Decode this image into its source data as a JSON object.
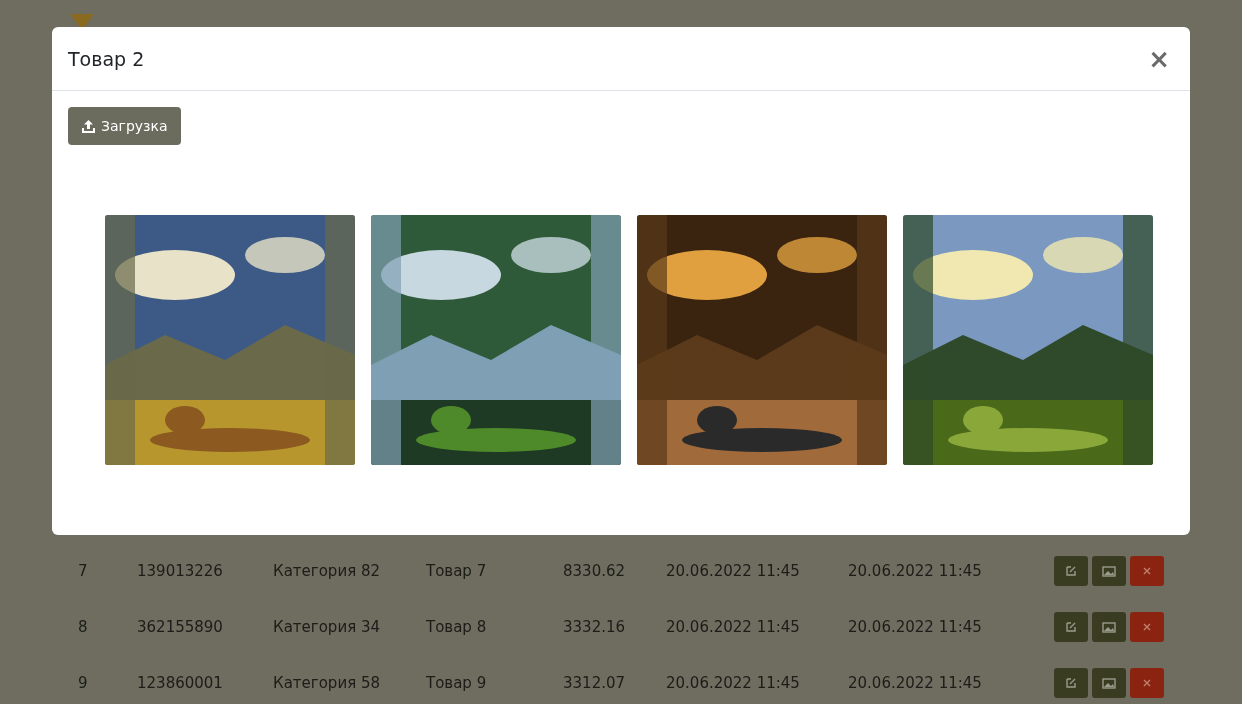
{
  "table": {
    "rows": [
      {
        "cells": [
          "7",
          "139013226",
          "Категория 82",
          "Товар 7",
          "8330.62",
          "20.06.2022 11:45",
          "20.06.2022 11:45"
        ]
      },
      {
        "cells": [
          "8",
          "362155890",
          "Категория 34",
          "Товар 8",
          "3332.16",
          "20.06.2022 11:45",
          "20.06.2022 11:45"
        ]
      },
      {
        "cells": [
          "9",
          "123860001",
          "Категория 58",
          "Товар 9",
          "3312.07",
          "20.06.2022 11:45",
          "20.06.2022 11:45"
        ]
      }
    ]
  },
  "modal": {
    "title": "Товар 2",
    "close": "×",
    "upload_button": "Загрузка"
  }
}
